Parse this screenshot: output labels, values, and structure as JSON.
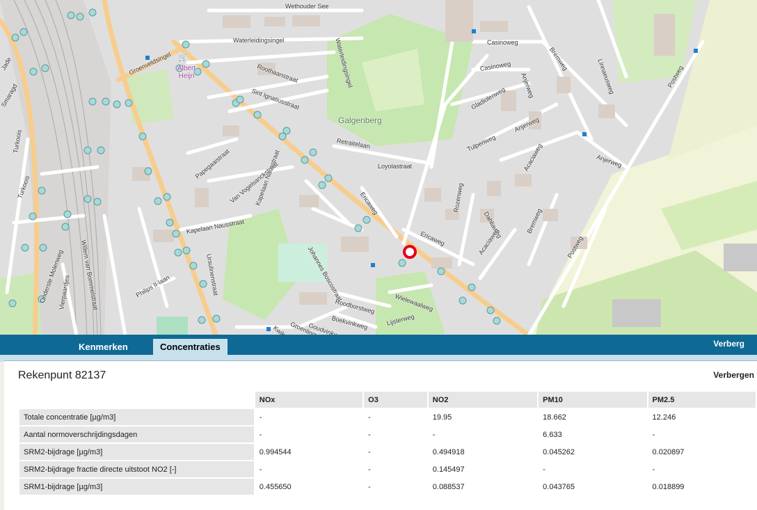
{
  "map": {
    "streets": [
      "Wethouder See",
      "Waterleidingsingel",
      "Waterleidingsingel",
      "Groenveldsingel",
      "Roothaanstraat",
      "Sint Ignatiusstraat",
      "Galgenberg",
      "Retraitelaan",
      "Loyolastraat",
      "Casinoweg",
      "Casinoweg",
      "Bremweg",
      "Linnaeusweg",
      "Anjerweg",
      "Gladiolenweg",
      "Tulpenweg",
      "Acaciaweg",
      "Anjerweg",
      "Anjerweg",
      "Postweg",
      "Rozenweg",
      "Dahliaweg",
      "Acaciaweg",
      "Bremweg",
      "Ericaweg",
      "Ericaweg",
      "Papegaaistraat",
      "Van Vogelsanckstraat",
      "Kapelaan Nausstraat",
      "Kapelaan Nausstraat",
      "Ursulinenstraat",
      "Johannes Boscostraat",
      "Roodborstweg",
      "Boekvinkweg",
      "Goudvinkweg",
      "Lijsterweg",
      "Wielewaalweg",
      "Willem van Bommelstraat",
      "Philips II-laan",
      "Turkoois",
      "Turkoois",
      "Onderste Molenweg",
      "Vierpaardjes",
      "Postweg",
      "Jade",
      "Smaragd",
      "Kwikstaartweg",
      "Groenlingweg"
    ],
    "poi": "Albert Heijn"
  },
  "tabs": [
    {
      "label": "Kenmerken"
    },
    {
      "label": "Concentraties"
    }
  ],
  "hide_label": "Verberg",
  "panel": {
    "title": "Rekenpunt 82137",
    "hide_label": "Verbergen",
    "columns": [
      "NOx",
      "O3",
      "NO2",
      "PM10",
      "PM2.5"
    ],
    "rows": [
      {
        "label": "Totale concentratie [µg/m3]",
        "values": [
          "-",
          "-",
          "19.95",
          "18.662",
          "12.246"
        ]
      },
      {
        "label": "Aantal normoverschrijdingsdagen",
        "values": [
          "-",
          "-",
          "-",
          "6.633",
          "-"
        ]
      },
      {
        "label": "SRM2-bijdrage [µg/m3]",
        "values": [
          "0.994544",
          "-",
          "0.494918",
          "0.045262",
          "0.020897"
        ]
      },
      {
        "label": "SRM2-bijdrage fractie directe uitstoot NO2 [-]",
        "values": [
          "-",
          "-",
          "0.145497",
          "-",
          "-"
        ]
      },
      {
        "label": "SRM1-bijdrage [µg/m3]",
        "values": [
          "0.455650",
          "-",
          "0.088537",
          "0.043765",
          "0.018899"
        ]
      }
    ]
  },
  "colors": {
    "tabbar": "#0e6994",
    "active_tab": "#c7e1ee",
    "marker": "#e3001b",
    "point": "#a8d8d8"
  }
}
